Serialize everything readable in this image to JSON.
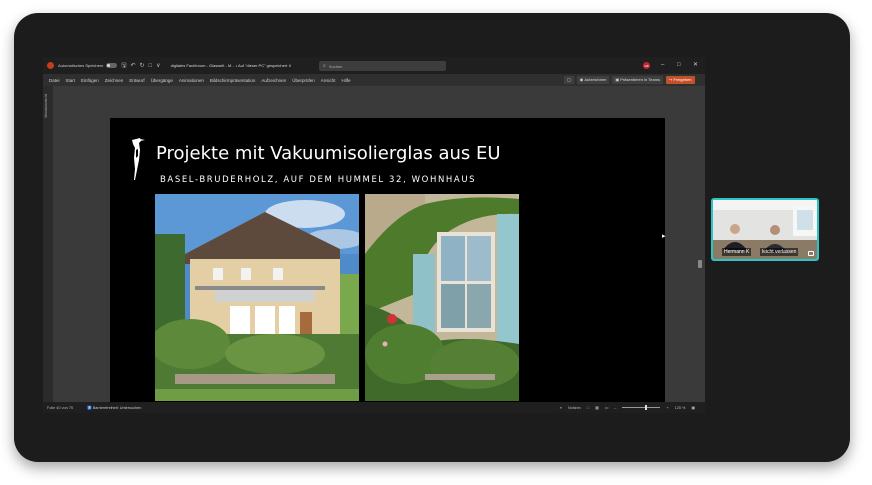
{
  "app": {
    "autosave_label": "Automatisches Speichern",
    "doc_title": "digitales Fachforum - Glaswelt - M...  •  Auf \"dieser PC\" gespeichert ∨",
    "search_placeholder": "Suchen",
    "user_initials": "GB"
  },
  "menu": {
    "items": [
      "Datei",
      "Start",
      "Einfügen",
      "Zeichnen",
      "Entwurf",
      "Übergänge",
      "Animationen",
      "Bildschirmpräsentation",
      "Aufzeichnen",
      "Überprüfen",
      "Ansicht",
      "Hilfe"
    ],
    "record_label": "Aufzeichnen",
    "present_teams_label": "Präsentieren in Teams",
    "share_label": "Freigeben"
  },
  "left_pane": {
    "label": "Miniaturansicht"
  },
  "slide": {
    "title": "Projekte mit Vakuumisolierglas aus EU",
    "subtitle": "BASEL-BRUDERHOLZ, AUF DEM HUMMEL 32, WOHNHAUS"
  },
  "status": {
    "slide_count": "Folie 40 von 75",
    "accessibility": "Barrierefreiheit: Untersuchen",
    "notes": "Notizen",
    "zoom": "125 %"
  },
  "video": {
    "participant_left": "Hermann K",
    "participant_right": "leicht verlassen"
  },
  "colors": {
    "accent_teams_border": "#2ec4c6",
    "share_button": "#c4502a",
    "powerpoint_red": "#c43e1c"
  }
}
